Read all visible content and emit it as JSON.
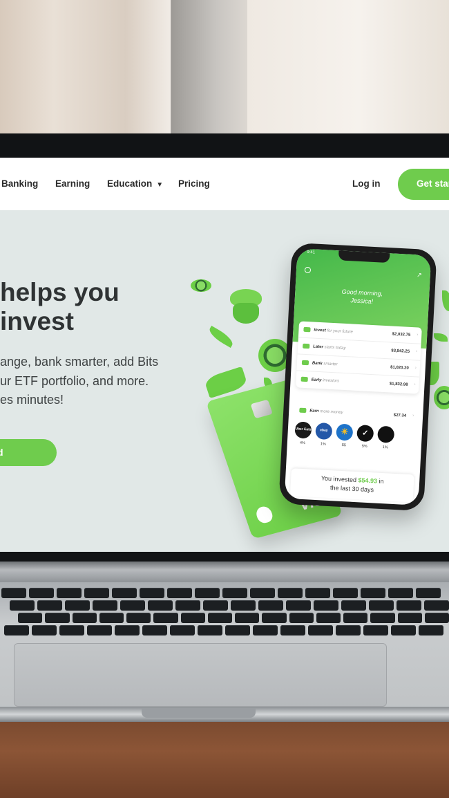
{
  "site": {
    "nav": {
      "items": [
        "Banking",
        "Earning",
        "Education",
        "Pricing"
      ],
      "login": "Log in",
      "cta": "Get star"
    },
    "hero": {
      "title_line1": "helps you",
      "title_line2": "invest",
      "subtitle_line1": "ange, bank smarter, add Bits",
      "subtitle_line2": "ur ETF portfolio, and more.",
      "subtitle_line3": "es minutes!",
      "button": "d"
    }
  },
  "card": {
    "brand": "VISA"
  },
  "phone": {
    "time": "9:41",
    "greeting_line1": "Good morning,",
    "greeting_line2": "Jessica!",
    "accounts": [
      {
        "name": "Invest",
        "sub": "for your future",
        "amount": "$2,032.75"
      },
      {
        "name": "Later",
        "sub": "starts today",
        "amount": "$3,942.25"
      },
      {
        "name": "Bank",
        "sub": "smarter",
        "amount": "$1,020.20"
      },
      {
        "name": "Early",
        "sub": "investors",
        "amount": "$1,832.98"
      }
    ],
    "earn": {
      "name": "Earn",
      "sub": "more money",
      "amount": "$27.34"
    },
    "partners": [
      {
        "name": "Uber Eats",
        "pct": "4%",
        "color": "#1a1a1a"
      },
      {
        "name": "ebay",
        "pct": "1%",
        "color": "#2458a8"
      },
      {
        "name": "Walmart",
        "pct": "$5",
        "color": "#1e73c9"
      },
      {
        "name": "Nike",
        "pct": "5%",
        "color": "#111111"
      },
      {
        "name": "",
        "pct": "1%",
        "color": "#111111"
      }
    ],
    "invested_text": "You invested",
    "invested_amount": "$54.93",
    "invested_suffix": "in",
    "invested_period": "the last 30 days"
  },
  "colors": {
    "brand_green": "#6fcc4d",
    "text_dark": "#2f3334"
  }
}
